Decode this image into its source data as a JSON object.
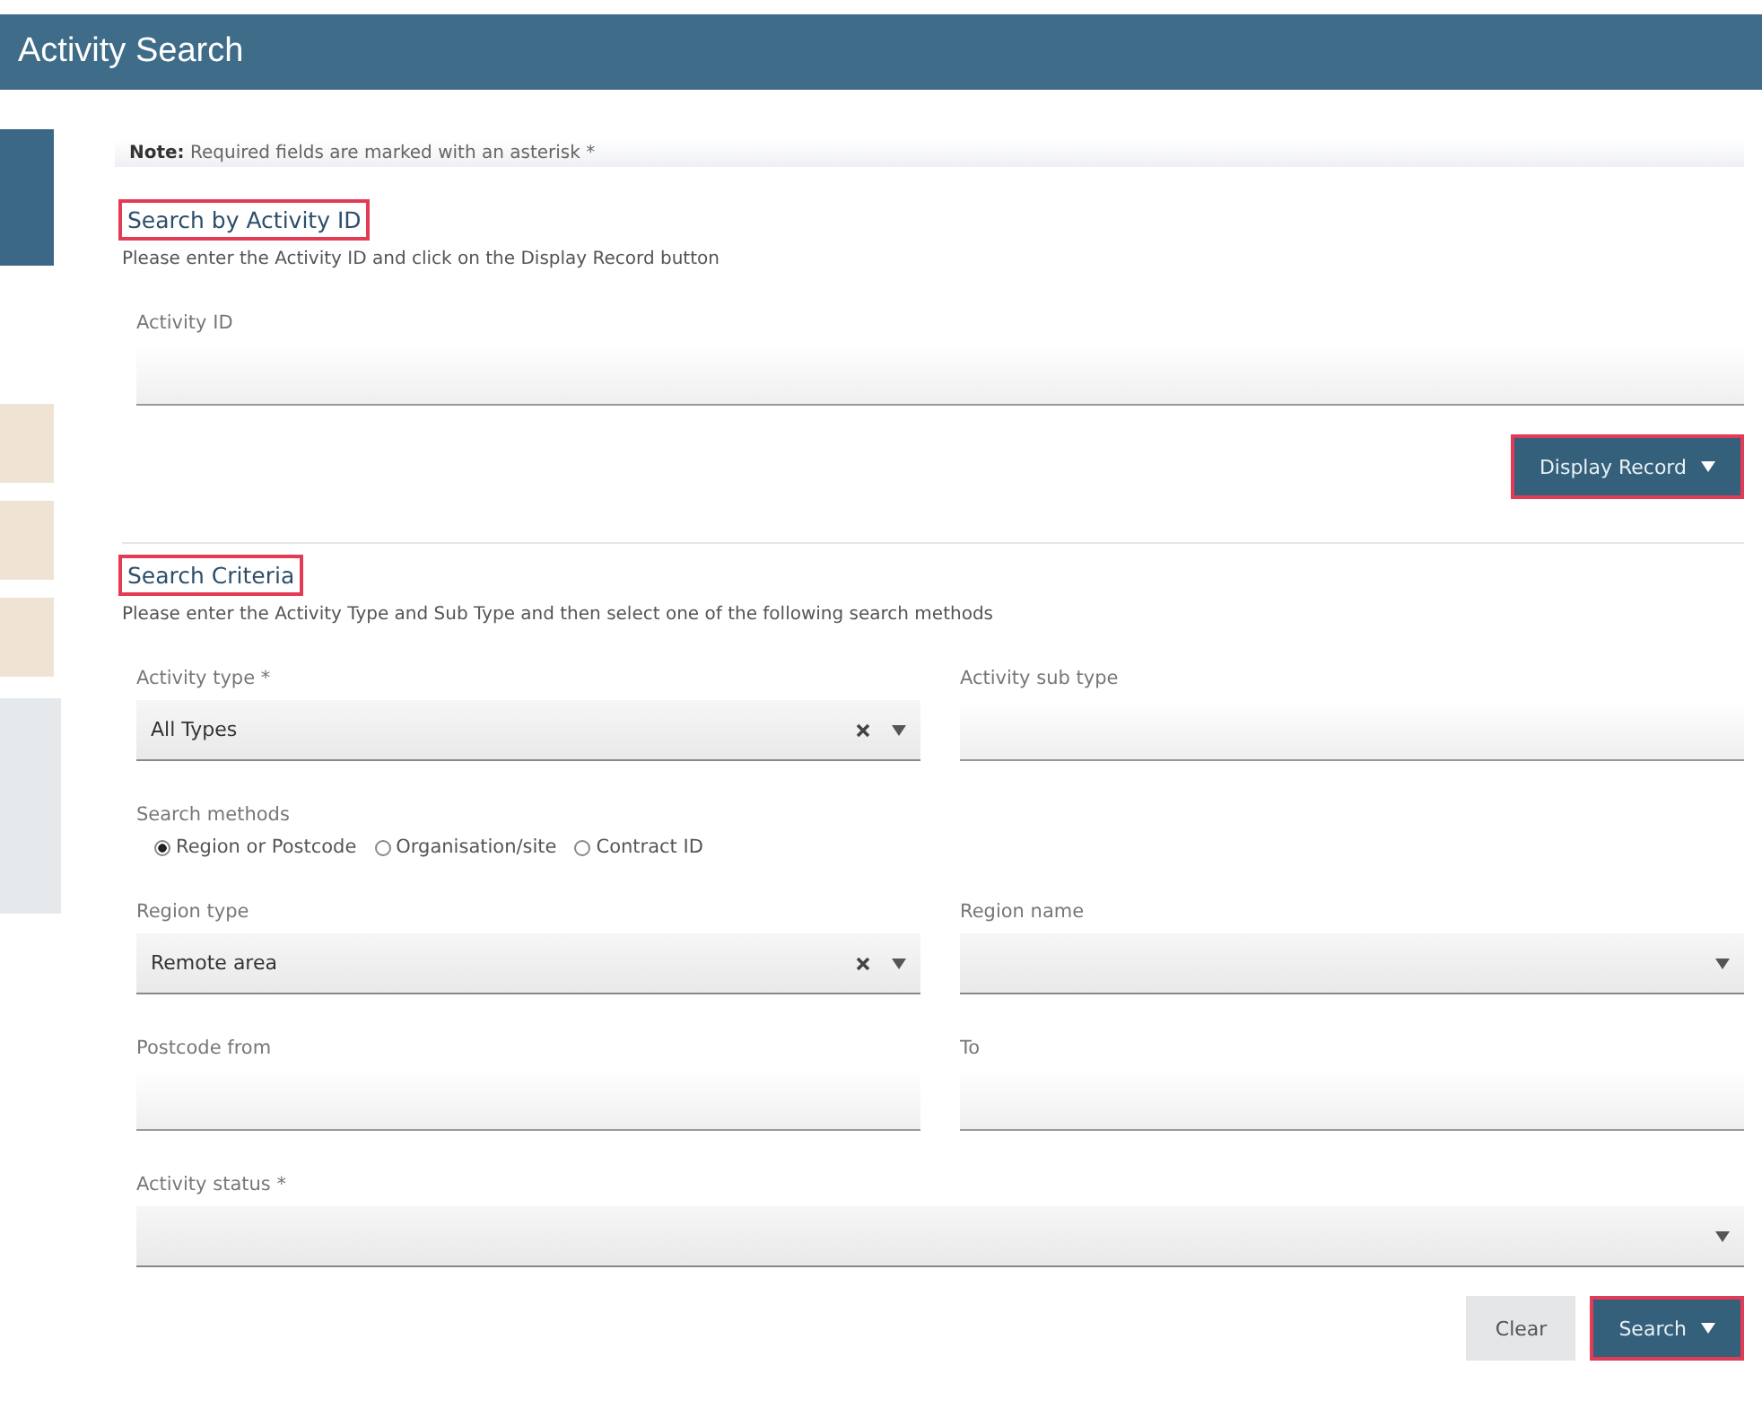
{
  "header": {
    "title": "Activity Search"
  },
  "sidebar": {
    "items": [
      {
        "color": "#3b6886"
      },
      {
        "color": "#efe4d3"
      },
      {
        "color": "#efe4d3"
      },
      {
        "color": "#efe4d3"
      },
      {
        "color": "#e6e9ec"
      }
    ]
  },
  "note": "**Note:** Required fields are marked with an asterisk *",
  "sections": [
    {
      "heading": "Search by Activity ID",
      "highlighted": true,
      "instruction": "Please enter the Activity ID and click on the Display Record button",
      "rows": [
        [
          {
            "kind": "text",
            "label": "Activity ID"
          }
        ]
      ],
      "buttons": [
        {
          "label": "Display Record",
          "kind": "primary",
          "highlighted": true
        }
      ]
    },
    {
      "heading": "Search Criteria",
      "highlighted": true,
      "instruction": "Please enter the Activity Type and Sub Type and then select one of the following search methods",
      "rows": [
        [
          {
            "kind": "select",
            "label": "Activity type *",
            "value": "All Types",
            "clearable": true
          },
          {
            "kind": "text",
            "label": "Activity sub type"
          }
        ],
        [
          {
            "kind": "radio",
            "label": "Search methods",
            "options": [
              {
                "label": "Region or Postcode",
                "selected": true
              },
              {
                "label": "Organisation/site",
                "selected": false
              },
              {
                "label": "Contract ID",
                "selected": false
              }
            ]
          }
        ],
        [
          {
            "kind": "select",
            "label": "Region type",
            "value": "Remote area",
            "clearable": true
          },
          {
            "kind": "select",
            "label": "Region name",
            "clearable": false
          }
        ],
        [
          {
            "kind": "text",
            "label": "Postcode from"
          },
          {
            "kind": "text",
            "label": "To"
          }
        ],
        [
          {
            "kind": "select",
            "label": "Activity status *",
            "clearable": false
          }
        ]
      ],
      "buttons": [
        {
          "label": "Clear",
          "kind": "secondary",
          "highlighted": false
        },
        {
          "label": "Search",
          "kind": "primary",
          "highlighted": true
        }
      ]
    }
  ]
}
